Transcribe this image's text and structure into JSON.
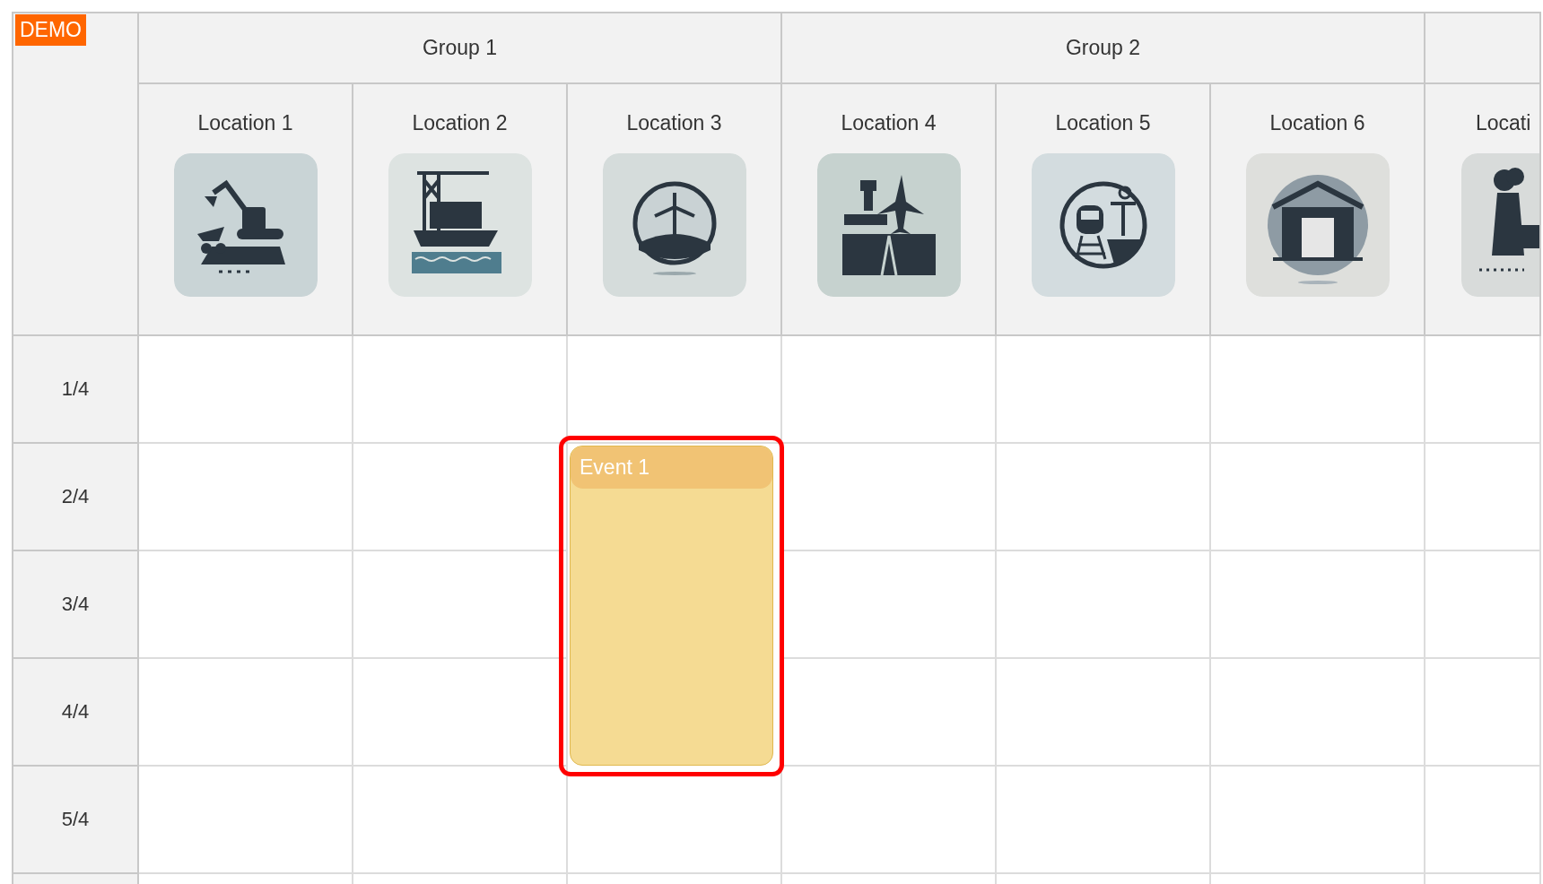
{
  "badge": "DEMO",
  "groups": [
    {
      "label": "Group 1",
      "locations": [
        {
          "label": "Location 1"
        },
        {
          "label": "Location 2"
        },
        {
          "label": "Location 3",
          "events": [
            {
              "title": "Event 1",
              "selected": true
            }
          ]
        }
      ]
    },
    {
      "label": "Group 2",
      "locations": [
        {
          "label": "Location 4"
        },
        {
          "label": "Location 5"
        },
        {
          "label": "Location 6"
        }
      ]
    },
    {
      "locations": [
        {
          "label": "Locati"
        }
      ]
    }
  ],
  "rows": [
    {
      "label": "1/4"
    },
    {
      "label": "2/4"
    },
    {
      "label": "3/4"
    },
    {
      "label": "4/4"
    },
    {
      "label": "5/4"
    }
  ]
}
